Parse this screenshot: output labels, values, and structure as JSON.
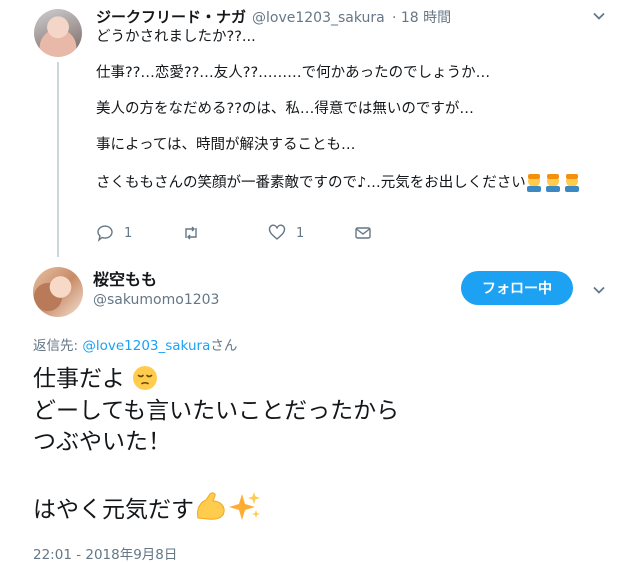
{
  "reply_tweet": {
    "author_name": "ジークフリード・ナガ",
    "author_handle": "@love1203_sakura",
    "time_ago": "· 18 時間",
    "lines": [
      "どうかされましたか??...",
      "仕事??…恋愛??…友人??………で何かあったのでしょうか…",
      "美人の方をなだめる??のは、私…得意では無いのですが…",
      "事によっては、時間が解決することも…",
      "さくももさんの笑顔が一番素敵ですので♪…元気をお出しください"
    ],
    "reply_count": "1",
    "retweet_count": "",
    "like_count": "1"
  },
  "main_tweet": {
    "author_name": "桜空もも",
    "author_handle": "@sakumomo1203",
    "follow_label": "フォロー中",
    "replying_prefix": "返信先: ",
    "replying_handle": "@love1203_sakura",
    "replying_suffix": "さん",
    "lines": [
      "仕事だよ",
      "どーしても言いたいことだったから",
      "つぶやいた！",
      "",
      "はやく元気だす"
    ],
    "timestamp": "22:01 - 2018年9月8日"
  },
  "icons": {
    "menu": "chevron-down-icon",
    "reply": "reply-icon",
    "retweet": "retweet-icon",
    "like": "heart-icon",
    "dm": "envelope-icon"
  },
  "colors": {
    "accent": "#1da1f2",
    "secondary_text": "#657786"
  }
}
